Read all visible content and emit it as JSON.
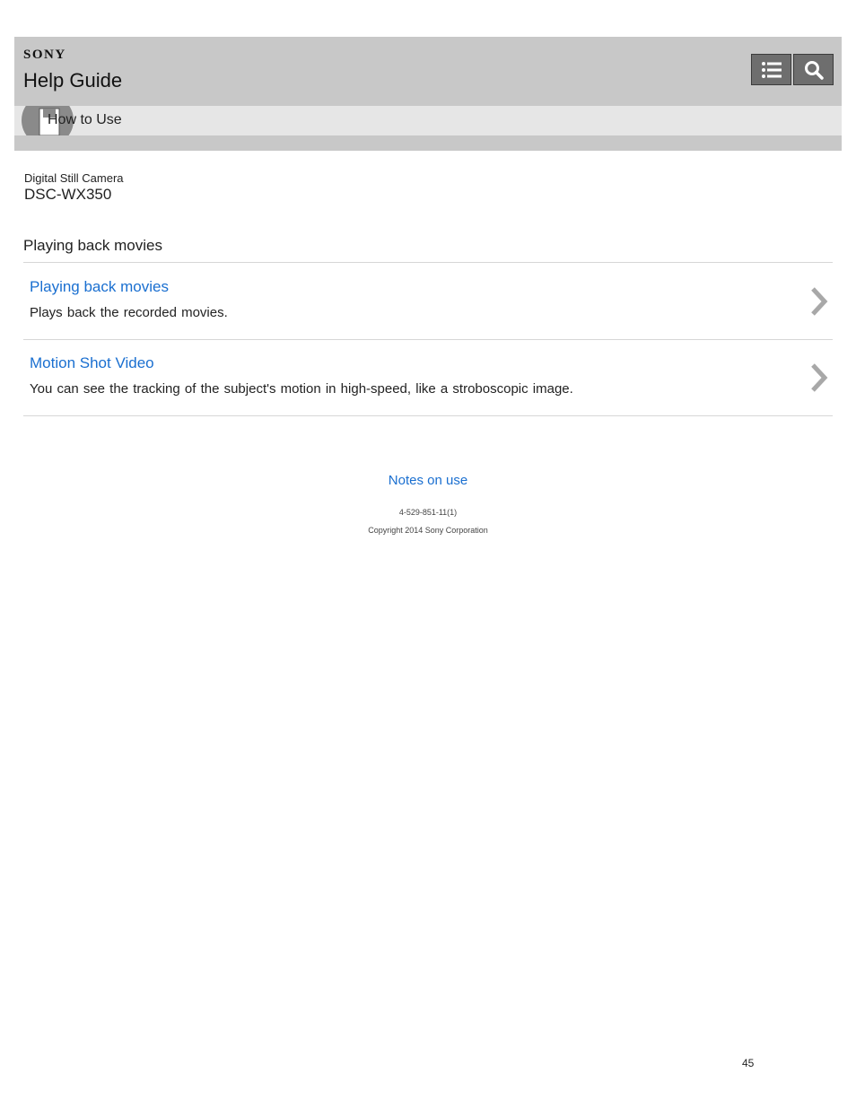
{
  "header": {
    "brand": "SONY",
    "title": "Help Guide",
    "breadcrumb": "How to Use"
  },
  "product": {
    "category": "Digital Still Camera",
    "model": "DSC-WX350"
  },
  "section": {
    "title": "Playing back movies"
  },
  "items": [
    {
      "link": "Playing back movies",
      "description": "Plays back the recorded movies."
    },
    {
      "link": "Motion Shot Video",
      "description": "You can see the tracking of the subject's motion in high-speed, like a stroboscopic image."
    }
  ],
  "footer": {
    "notes_link": "Notes on use",
    "doc_id": "4-529-851-11(1)",
    "copyright": "Copyright 2014 Sony Corporation",
    "page_number": "45"
  },
  "icons": {
    "toc": "list-icon",
    "search": "search-icon",
    "breadcrumb": "book-icon",
    "arrow": "chevron-right-icon"
  },
  "colors": {
    "link": "#1a6fd0",
    "header_bg": "#c8c8c8",
    "crumb_bg": "#e6e6e6",
    "tool_bg": "#6e6e6e"
  }
}
